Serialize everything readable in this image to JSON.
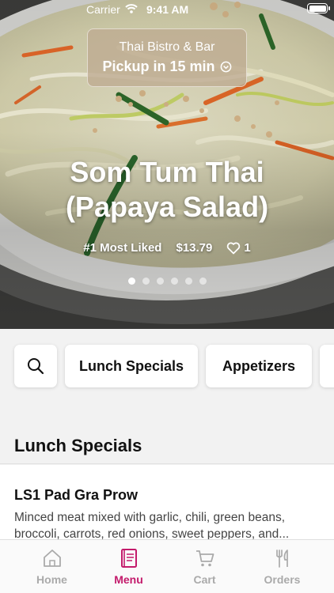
{
  "status_bar": {
    "carrier": "Carrier",
    "time": "9:41 AM"
  },
  "pickup": {
    "restaurant": "Thai Bistro & Bar",
    "label": "Pickup in 15 min"
  },
  "featured": {
    "title_line1": "Som Tum Thai",
    "title_line2": "(Papaya Salad)",
    "badge": "#1 Most Liked",
    "price": "$13.79",
    "likes": "1",
    "pages": 6,
    "active_page": 1
  },
  "categories": [
    "Lunch Specials",
    "Appetizers"
  ],
  "section": {
    "title": "Lunch Specials"
  },
  "items": [
    {
      "name": "LS1 Pad Gra Prow",
      "description": "Minced meat mixed with garlic, chili, green beans, broccoli, carrots, red onions, sweet peppers, and..."
    }
  ],
  "tabs": [
    {
      "label": "Home",
      "icon": "home-icon",
      "active": false
    },
    {
      "label": "Menu",
      "icon": "menu-book-icon",
      "active": true
    },
    {
      "label": "Cart",
      "icon": "cart-icon",
      "active": false
    },
    {
      "label": "Orders",
      "icon": "fork-knife-icon",
      "active": false
    }
  ],
  "colors": {
    "accent": "#c31a6b",
    "inactive_tab": "#aaaaaa",
    "background": "#f2f2f2"
  }
}
